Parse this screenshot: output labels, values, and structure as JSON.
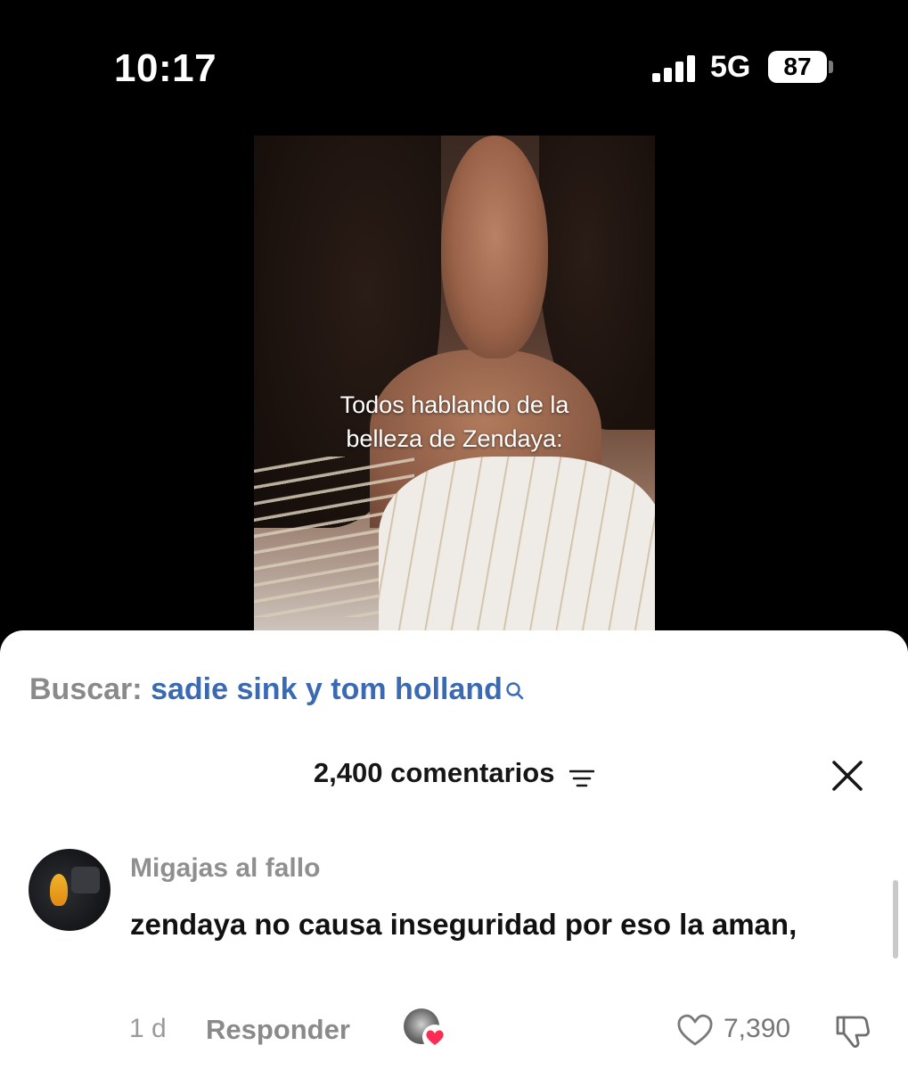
{
  "status_bar": {
    "time": "10:17",
    "network": "5G",
    "battery": "87"
  },
  "video": {
    "caption_line1": "Todos hablando de la",
    "caption_line2": "belleza de Zendaya:"
  },
  "search": {
    "prefix": "Buscar:",
    "query": "sadie sink y tom holland",
    "icon": "search-icon"
  },
  "comments": {
    "header": "2,400 comentarios",
    "filter_icon": "filter-icon",
    "close_icon": "close-icon",
    "items": [
      {
        "user": "Migajas al fallo",
        "text": "zendaya no causa inseguridad por eso la aman,",
        "time": "1 d",
        "reply_label": "Responder",
        "likes": "7,390"
      }
    ]
  },
  "colors": {
    "search_query": "#3b6ab4",
    "heart_badge": "#fe2c55"
  }
}
